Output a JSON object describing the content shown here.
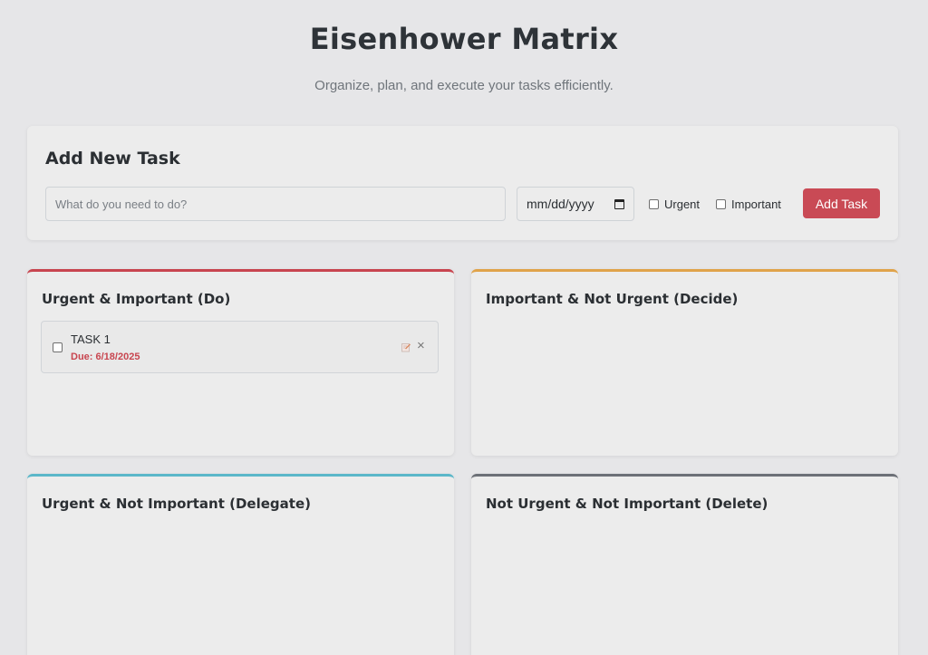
{
  "header": {
    "title": "Eisenhower Matrix",
    "subtitle": "Organize, plan, and execute your tasks efficiently."
  },
  "add_task": {
    "heading": "Add New Task",
    "input_placeholder": "What do you need to do?",
    "input_value": "",
    "date_placeholder": "mm/dd/yyyy",
    "urgent_label": "Urgent",
    "urgent_checked": false,
    "important_label": "Important",
    "important_checked": false,
    "button_label": "Add Task",
    "button_color": "#c94a55"
  },
  "quadrants": [
    {
      "title": "Urgent & Important (Do)",
      "accent": "#c8454f",
      "tasks": [
        {
          "name": "TASK 1",
          "due": "Due: 6/18/2025",
          "completed": false,
          "icons": [
            "edit-icon",
            "close-icon"
          ]
        }
      ]
    },
    {
      "title": "Important & Not Urgent (Decide)",
      "accent": "#e0a34a",
      "tasks": []
    },
    {
      "title": "Urgent & Not Important (Delegate)",
      "accent": "#5bb7c9",
      "tasks": []
    },
    {
      "title": "Not Urgent & Not Important (Delete)",
      "accent": "#6c7077",
      "tasks": []
    }
  ]
}
